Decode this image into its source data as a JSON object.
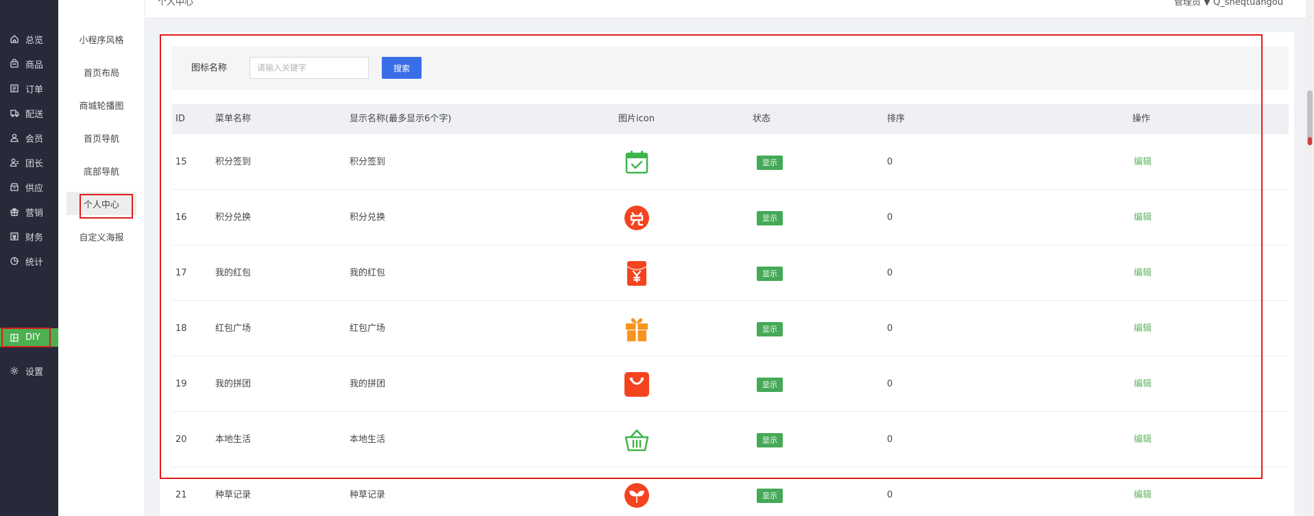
{
  "header": {
    "breadcrumb": "个人中心",
    "user_text": "管理员 ▼ Q_sheqtuangou"
  },
  "main_nav": {
    "items": [
      {
        "label": "总览",
        "icon": "home-icon"
      },
      {
        "label": "商品",
        "icon": "goods-icon"
      },
      {
        "label": "订单",
        "icon": "order-icon"
      },
      {
        "label": "配送",
        "icon": "delivery-icon"
      },
      {
        "label": "会员",
        "icon": "member-icon"
      },
      {
        "label": "团长",
        "icon": "leader-icon"
      },
      {
        "label": "供应",
        "icon": "supply-icon"
      },
      {
        "label": "营销",
        "icon": "gift-icon"
      },
      {
        "label": "财务",
        "icon": "finance-icon"
      },
      {
        "label": "统计",
        "icon": "chart-icon"
      },
      {
        "label": "DIY",
        "icon": "layout-icon",
        "active": true
      },
      {
        "label": "设置",
        "icon": "gear-icon"
      }
    ]
  },
  "sub_nav": {
    "items": [
      {
        "label": "小程序风格"
      },
      {
        "label": "首页布局"
      },
      {
        "label": "商城轮播图"
      },
      {
        "label": "首页导航"
      },
      {
        "label": "底部导航"
      },
      {
        "label": "个人中心",
        "active": true
      },
      {
        "label": "自定义海报"
      }
    ]
  },
  "search": {
    "label": "图标名称",
    "placeholder": "请输入关键字",
    "button_label": "搜索"
  },
  "table": {
    "columns": [
      "ID",
      "菜单名称",
      "显示名称(最多显示6个字)",
      "图片icon",
      "状态",
      "排序",
      "操作"
    ],
    "rows": [
      {
        "id": "15",
        "menu_name": "积分签到",
        "display_name": "积分签到",
        "icon": "calendar-check-icon",
        "status": "显示",
        "sort": "0",
        "action": "编辑"
      },
      {
        "id": "16",
        "menu_name": "积分兑换",
        "display_name": "积分兑换",
        "icon": "exchange-icon",
        "status": "显示",
        "sort": "0",
        "action": "编辑"
      },
      {
        "id": "17",
        "menu_name": "我的红包",
        "display_name": "我的红包",
        "icon": "red-envelope-icon",
        "status": "显示",
        "sort": "0",
        "action": "编辑"
      },
      {
        "id": "18",
        "menu_name": "红包广场",
        "display_name": "红包广场",
        "icon": "gift-box-icon",
        "status": "显示",
        "sort": "0",
        "action": "编辑"
      },
      {
        "id": "19",
        "menu_name": "我的拼团",
        "display_name": "我的拼团",
        "icon": "shopping-bag-icon",
        "status": "显示",
        "sort": "0",
        "action": "编辑"
      },
      {
        "id": "20",
        "menu_name": "本地生活",
        "display_name": "本地生活",
        "icon": "basket-icon",
        "status": "显示",
        "sort": "0",
        "action": "编辑"
      },
      {
        "id": "21",
        "menu_name": "种草记录",
        "display_name": "种草记录",
        "icon": "sprout-icon",
        "status": "显示",
        "sort": "0",
        "action": "编辑"
      }
    ]
  },
  "colors": {
    "sidebar_bg": "#282a3a",
    "active_green": "#4caf50",
    "status_green": "#45a957",
    "primary_blue": "#3a6ee8",
    "highlight_red": "#e01a1a",
    "icon_green": "#3db54a",
    "icon_red": "#f3431f",
    "icon_orange": "#f7931e"
  }
}
